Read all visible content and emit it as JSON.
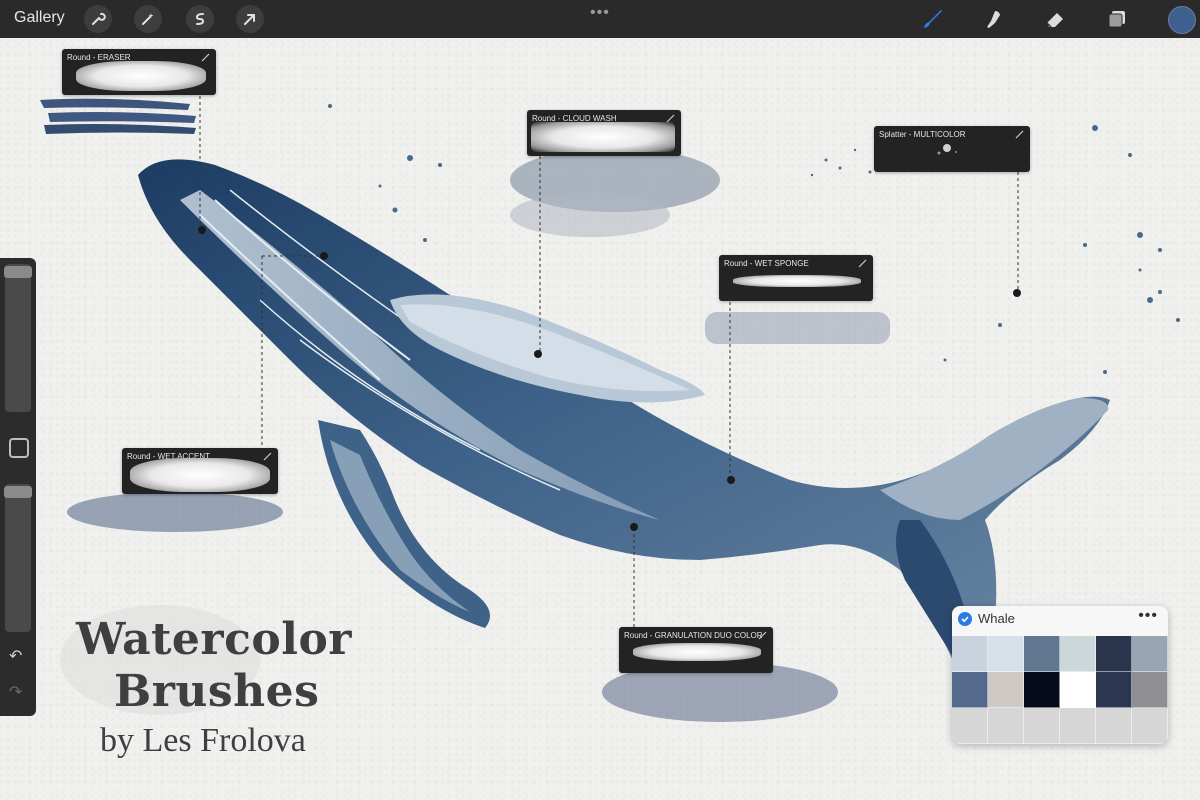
{
  "topbar": {
    "gallery_label": "Gallery",
    "actions": [
      "wrench-icon",
      "magic-wand-icon",
      "selection-s-icon",
      "transform-arrow-icon"
    ],
    "tools": [
      "brush-icon",
      "smudge-icon",
      "eraser-icon",
      "layers-icon"
    ],
    "current_color": "#3f5f8e"
  },
  "brushes": [
    {
      "label": "Round - ERASER"
    },
    {
      "label": "Round - CLOUD WASH"
    },
    {
      "label": "Splatter - MULTICOLOR"
    },
    {
      "label": "Round - WET SPONGE"
    },
    {
      "label": "Round - WET ACCENT"
    },
    {
      "label": "Round - GRANULATION DUO COLOR"
    }
  ],
  "title": {
    "line1": "Watercolor",
    "line2": "Brushes",
    "byline": "by Les Frolova"
  },
  "palette": {
    "name": "Whale",
    "more_label": "•••",
    "swatches": [
      "#c9d3dd",
      "#d7e0e8",
      "#5f7890",
      "#cdd7da",
      "#2a354d",
      "#97a6b2",
      "#536a8c",
      "#cfc9c6",
      "#050a1c",
      "#ffffff",
      "#2b3650",
      "#8f8f93",
      "#d6d6d6",
      "#d6d6d6",
      "#d6d6d6",
      "#d6d6d6",
      "#d6d6d6",
      "#d6d6d6"
    ]
  },
  "colors": {
    "whale_dark": "#1f3e66",
    "whale_mid": "#4f6f94",
    "whale_light": "#c4d0dc",
    "ink": "#2a3d5c"
  }
}
